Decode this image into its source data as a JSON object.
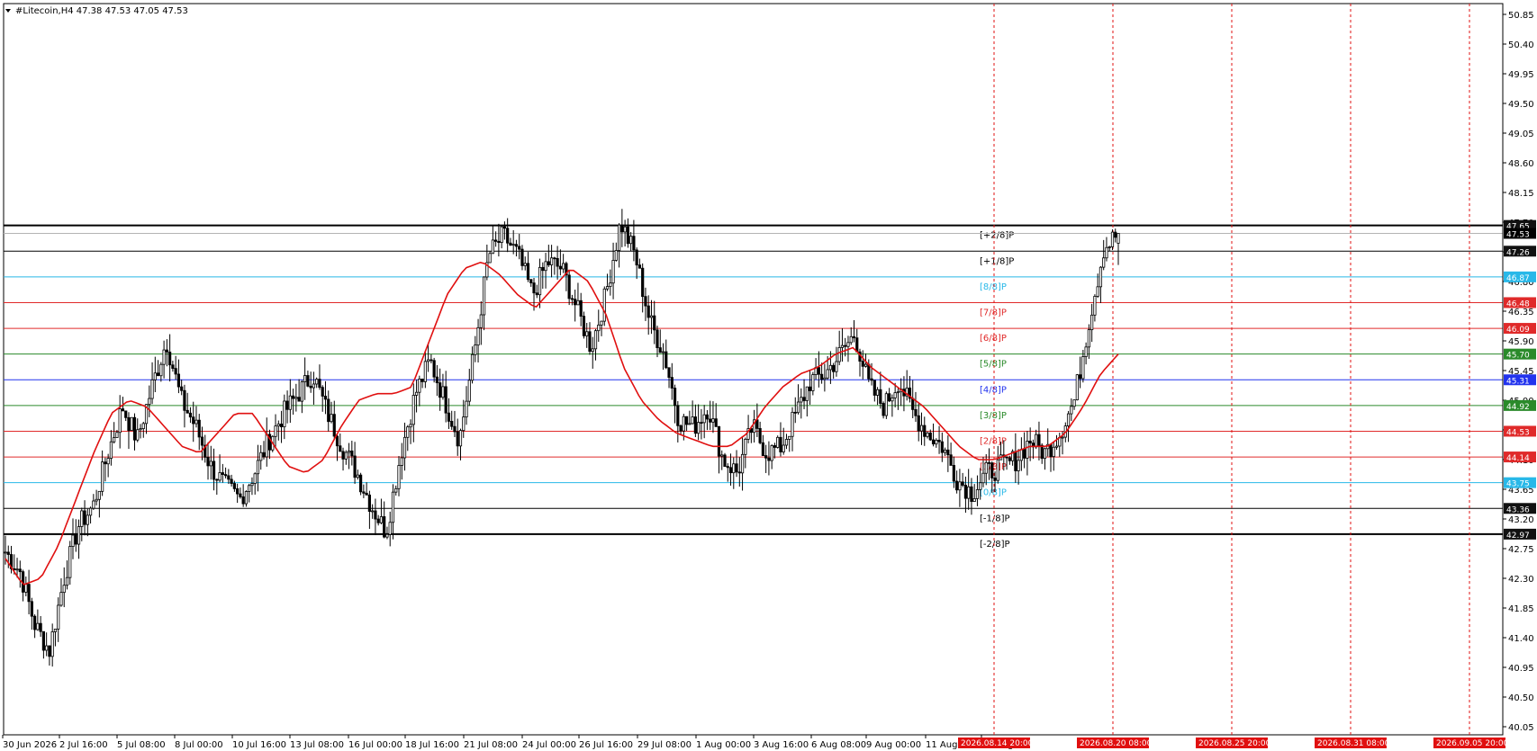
{
  "header": {
    "symbol_line": "#Litecoin,H4  47.38 47.53 47.05 47.53"
  },
  "chart_data": {
    "type": "candlestick",
    "symbol": "#Litecoin",
    "timeframe": "H4",
    "ohlc_last": {
      "open": 47.38,
      "high": 47.53,
      "low": 47.05,
      "close": 47.53
    },
    "ylim": [
      40.05,
      50.85
    ],
    "y_ticks": [
      "50.85",
      "50.40",
      "49.95",
      "49.50",
      "49.05",
      "48.60",
      "48.15",
      "47.70",
      "47.25",
      "46.80",
      "46.35",
      "45.90",
      "45.45",
      "45.00",
      "44.55",
      "44.10",
      "43.65",
      "43.20",
      "42.75",
      "42.30",
      "41.85",
      "41.40",
      "40.95",
      "40.50",
      "40.05"
    ],
    "x_ticks": [
      "30 Jun 2026",
      "2 Jul 16:00",
      "5 Jul 08:00",
      "8 Jul 00:00",
      "10 Jul 16:00",
      "13 Jul 08:00",
      "16 Jul 00:00",
      "18 Jul 16:00",
      "21 Jul 08:00",
      "24 Jul 00:00",
      "26 Jul 16:00",
      "29 Jul 08:00",
      "1 Aug 00:00",
      "3 Aug 16:00",
      "6 Aug 08:00",
      "9 Aug 00:00",
      "11 Aug 1",
      "17 Aug 00"
    ],
    "close_path": [
      42.7,
      42.4,
      41.6,
      41.2,
      42.3,
      43.1,
      43.4,
      44.2,
      44.9,
      44.4,
      45.2,
      45.9,
      45.0,
      44.6,
      44.0,
      43.7,
      43.5,
      43.9,
      44.4,
      44.8,
      45.1,
      45.4,
      44.8,
      44.3,
      43.9,
      43.4,
      43.0,
      44.2,
      45.1,
      45.6,
      45.0,
      44.4,
      45.7,
      47.2,
      47.5,
      47.2,
      46.6,
      47.1,
      47.0,
      46.4,
      45.8,
      46.6,
      47.7,
      47.2,
      46.2,
      45.7,
      44.7,
      44.6,
      44.9,
      44.1,
      43.9,
      44.6,
      44.2,
      44.3,
      44.8,
      45.3,
      45.4,
      45.7,
      46.0,
      45.2,
      44.9,
      45.3,
      44.8,
      44.5,
      44.3,
      43.8,
      43.6,
      43.9,
      44.0,
      44.1,
      44.4,
      44.2,
      44.5,
      45.0,
      46.2,
      47.3,
      47.53
    ],
    "ma_path": [
      42.6,
      42.2,
      42.3,
      42.8,
      43.5,
      44.2,
      44.8,
      45.0,
      44.9,
      44.6,
      44.3,
      44.2,
      44.5,
      44.8,
      44.8,
      44.4,
      44.0,
      43.9,
      44.1,
      44.6,
      45.0,
      45.1,
      45.1,
      45.2,
      45.9,
      46.6,
      47.0,
      47.1,
      46.9,
      46.6,
      46.4,
      46.7,
      47.0,
      46.8,
      46.3,
      45.5,
      45.0,
      44.7,
      44.5,
      44.4,
      44.3,
      44.3,
      44.5,
      44.9,
      45.2,
      45.4,
      45.5,
      45.7,
      45.8,
      45.5,
      45.3,
      45.1,
      44.9,
      44.6,
      44.3,
      44.1,
      44.1,
      44.2,
      44.3,
      44.3,
      44.5,
      44.9,
      45.4,
      45.7
    ],
    "ma_color": "#e01010",
    "murrey_lines": [
      {
        "label": "[+2/8]P",
        "value": 47.65,
        "price_tag": "47.65",
        "color": "#000000",
        "thick": true
      },
      {
        "label": "[+1/8]P",
        "value": 47.26,
        "price_tag": "47.26",
        "color": "#000000",
        "thick": false
      },
      {
        "label": "[8/8]P",
        "value": 46.87,
        "price_tag": "46.87",
        "color": "#28b8e8",
        "thick": false
      },
      {
        "label": "[7/8]P",
        "value": 46.48,
        "price_tag": "46.48",
        "color": "#e02a2a",
        "thick": false
      },
      {
        "label": "[6/8]P",
        "value": 46.09,
        "price_tag": "46.09",
        "color": "#e02a2a",
        "thick": false
      },
      {
        "label": "[5/8]P",
        "value": 45.7,
        "price_tag": "45.70",
        "color": "#2a8a2a",
        "thick": false
      },
      {
        "label": "[4/8]P",
        "value": 45.31,
        "price_tag": "45.31",
        "color": "#2233ee",
        "thick": false
      },
      {
        "label": "[3/8]P",
        "value": 44.92,
        "price_tag": "44.92",
        "color": "#2a8a2a",
        "thick": false
      },
      {
        "label": "[2/8]P",
        "value": 44.53,
        "price_tag": "44.53",
        "color": "#e02a2a",
        "thick": false
      },
      {
        "label": "[1/8]P",
        "value": 44.14,
        "price_tag": "44.14",
        "color": "#e02a2a",
        "thick": false
      },
      {
        "label": "[0/8]P",
        "value": 43.75,
        "price_tag": "43.75",
        "color": "#28b8e8",
        "thick": false
      },
      {
        "label": "[-1/8]P",
        "value": 43.36,
        "price_tag": "43.36",
        "color": "#000000",
        "thick": false
      },
      {
        "label": "[-2/8]P",
        "value": 42.97,
        "price_tag": "42.97",
        "color": "#000000",
        "thick": true
      }
    ],
    "current_price": {
      "value": 47.53,
      "tag": "47.53",
      "color": "#b4b4b4"
    },
    "vertical_markers": [
      {
        "label": "2026.08.14 20:00",
        "color": "#e01010"
      },
      {
        "label": "2026.08.20 08:00",
        "color": "#e01010"
      },
      {
        "label": "2026.08.25 20:00",
        "color": "#e01010"
      },
      {
        "label": "2026.08.31 08:00",
        "color": "#e01010"
      },
      {
        "label": "2026.09.05 20:00",
        "color": "#e01010"
      }
    ],
    "candle_color": "#000000",
    "grid": false
  }
}
